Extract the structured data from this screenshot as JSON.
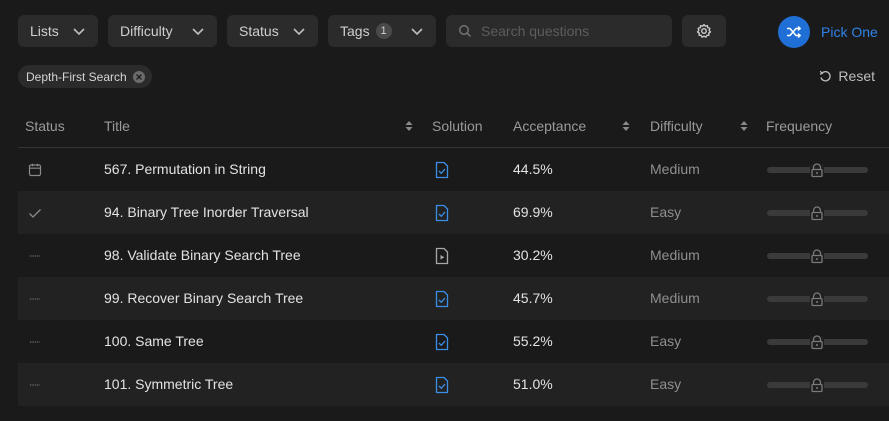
{
  "filters": {
    "lists_label": "Lists",
    "difficulty_label": "Difficulty",
    "status_label": "Status",
    "tags_label": "Tags",
    "tags_count": "1",
    "search_placeholder": "Search questions",
    "pick_one_label": "Pick One"
  },
  "active_filter": {
    "chip_label": "Depth-First Search",
    "reset_label": "Reset"
  },
  "table": {
    "headers": {
      "status": "Status",
      "title": "Title",
      "solution": "Solution",
      "acceptance": "Acceptance",
      "difficulty": "Difficulty",
      "frequency": "Frequency"
    },
    "rows": [
      {
        "status_icon": "calendar-icon",
        "title": "567. Permutation in String",
        "solution_icon": "solution-doc-check-icon",
        "acceptance": "44.5%",
        "difficulty": "Medium",
        "frequency_icon": "lock-icon"
      },
      {
        "status_icon": "check-icon",
        "title": "94. Binary Tree Inorder Traversal",
        "solution_icon": "solution-doc-check-icon",
        "acceptance": "69.9%",
        "difficulty": "Easy",
        "frequency_icon": "lock-icon"
      },
      {
        "status_icon": "dash-icon",
        "title": "98. Validate Binary Search Tree",
        "solution_icon": "solution-doc-video-icon",
        "acceptance": "30.2%",
        "difficulty": "Medium",
        "frequency_icon": "lock-icon"
      },
      {
        "status_icon": "dash-icon",
        "title": "99. Recover Binary Search Tree",
        "solution_icon": "solution-doc-check-icon",
        "acceptance": "45.7%",
        "difficulty": "Medium",
        "frequency_icon": "lock-icon"
      },
      {
        "status_icon": "dash-icon",
        "title": "100. Same Tree",
        "solution_icon": "solution-doc-check-icon",
        "acceptance": "55.2%",
        "difficulty": "Easy",
        "frequency_icon": "lock-icon"
      },
      {
        "status_icon": "dash-icon",
        "title": "101. Symmetric Tree",
        "solution_icon": "solution-doc-check-icon",
        "acceptance": "51.0%",
        "difficulty": "Easy",
        "frequency_icon": "lock-icon"
      }
    ]
  },
  "colors": {
    "accent": "#1f6fd6",
    "accent_text": "#2f83e8",
    "solution_icon": "#3b8fe8",
    "background": "#1a1a1a",
    "row_alt": "#222222"
  }
}
